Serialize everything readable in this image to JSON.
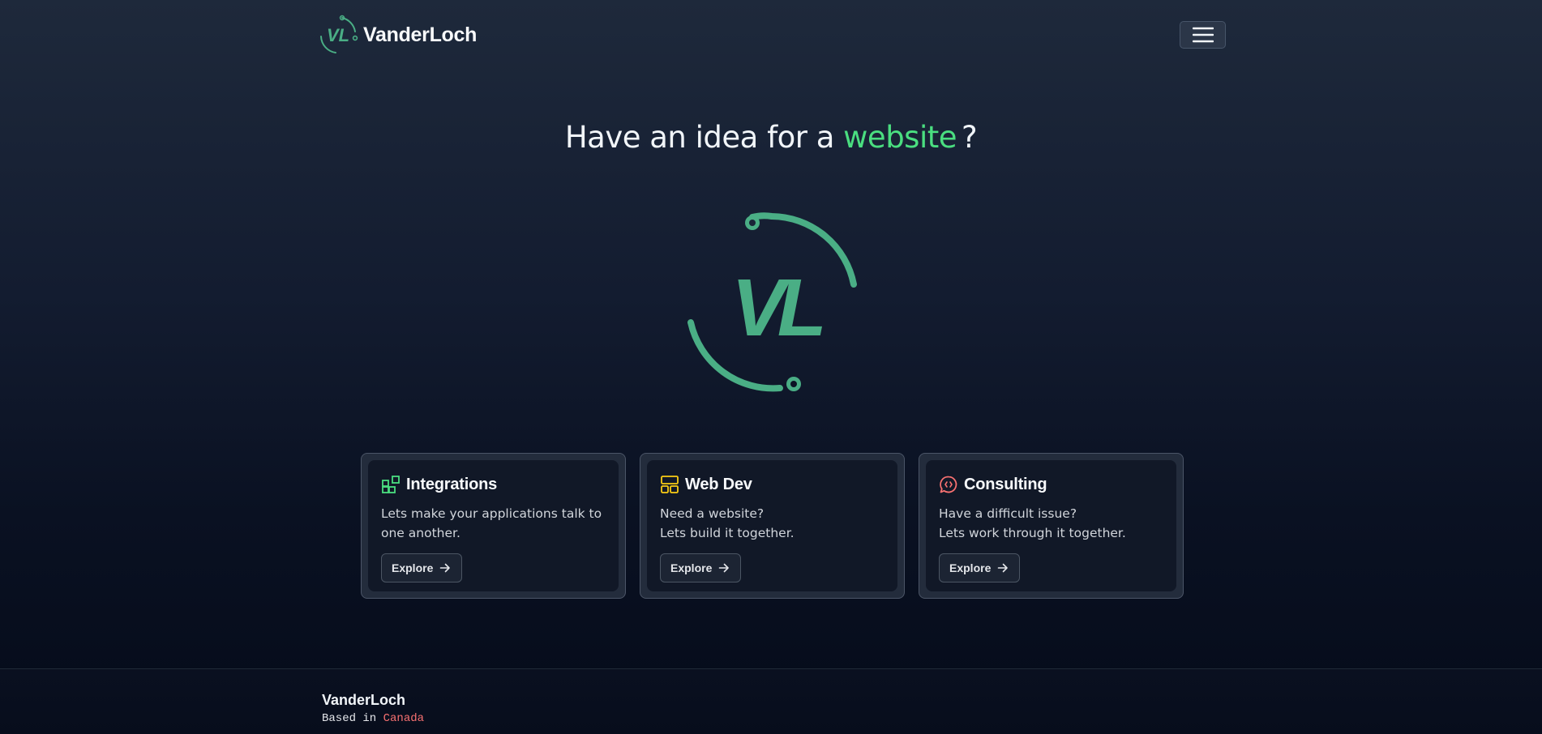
{
  "header": {
    "brand_name": "VanderLoch",
    "logo_icon": "vl-logo-icon",
    "menu_icon": "hamburger-menu-icon"
  },
  "hero": {
    "title_prefix": "Have an idea for a",
    "title_accent": "website",
    "title_suffix": "?",
    "logo_text": "VL"
  },
  "cards": [
    {
      "icon": "integrations-grid-icon",
      "title": "Integrations",
      "description_lines": [
        "Lets make your applications talk to",
        "one another."
      ],
      "button_label": "Explore"
    },
    {
      "icon": "layout-panels-icon",
      "title": "Web Dev",
      "description_lines": [
        "Need a website?",
        "Lets build it together."
      ],
      "button_label": "Explore"
    },
    {
      "icon": "chat-code-icon",
      "title": "Consulting",
      "description_lines": [
        "Have a difficult issue?",
        "Lets work through it together."
      ],
      "button_label": "Explore"
    }
  ],
  "footer": {
    "brand_name": "VanderLoch",
    "based_prefix": "Based in",
    "based_location": "Canada"
  },
  "colors": {
    "accent_green": "#4ade80",
    "logo_green": "#4aae85",
    "integrations_icon": "#4ade80",
    "webdev_icon": "#facc15",
    "consulting_icon": "#f87171",
    "location_red": "#f87171"
  }
}
